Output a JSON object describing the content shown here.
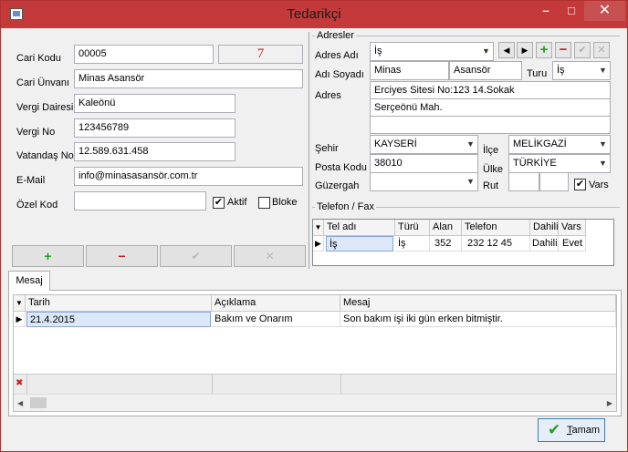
{
  "window": {
    "title": "Tedarikçi",
    "minimize": "–",
    "maximize": "□",
    "close": "✕"
  },
  "left": {
    "cari_kodu_label": "Cari Kodu",
    "cari_kodu": "00005",
    "cari_count": "7",
    "cari_unvani_label": "Cari Ünvanı",
    "cari_unvani": "Minas Asansör",
    "vergi_dairesi_label": "Vergi Dairesi",
    "vergi_dairesi": "Kaleönü",
    "vergi_no_label": "Vergi No",
    "vergi_no": "123456789",
    "vatandas_no_label": "Vatandaş No",
    "vatandas_no": "12.589.631.458",
    "email_label": "E-Mail",
    "email": "info@minasasansör.com.tr",
    "ozel_kod_label": "Özel Kod",
    "ozel_kod": "",
    "aktif_label": "Aktif",
    "aktif_checked": true,
    "bloke_label": "Bloke",
    "bloke_checked": false,
    "buttons": {
      "add": "+",
      "remove": "−",
      "confirm": "✔",
      "cancel": "✕"
    }
  },
  "adresler": {
    "title": "Adresler",
    "adres_adi_label": "Adres Adı",
    "adres_adi": "İş",
    "nav": {
      "prev": "◀",
      "next": "▶",
      "add": "+",
      "remove": "−",
      "confirm": "✔",
      "cancel": "✕"
    },
    "adi_soyadi_label": "Adı Soyadı",
    "adi": "Minas",
    "soyadi": "Asansör",
    "turu_label": "Turu",
    "turu": "İş",
    "adres_label": "Adres",
    "adres_line1": "Erciyes Sitesi No:123 14.Sokak",
    "adres_line2": "Serçeönü Mah.",
    "adres_line3": "",
    "sehir_label": "Şehir",
    "sehir": "KAYSERİ",
    "ilce_label": "İlçe",
    "ilce": "MELİKGAZİ",
    "posta_kodu_label": "Posta Kodu",
    "posta_kodu": "38010",
    "ulke_label": "Ülke",
    "ulke": "TÜRKİYE",
    "guzergah_label": "Güzergah",
    "guzergah": "",
    "rut_label": "Rut",
    "rut1": "",
    "rut2": "",
    "vars_label": "Vars",
    "vars_checked": true
  },
  "telefon": {
    "title": "Telefon / Fax",
    "columns": [
      "Tel adı",
      "Türü",
      "Alan",
      "Telefon",
      "Dahili",
      "Vars"
    ],
    "rows": [
      {
        "tel_adi": "İş",
        "turu": "İş",
        "alan": "352",
        "telefon": "232 12 45",
        "dahili": "Dahili",
        "vars": "Evet"
      }
    ]
  },
  "mesaj": {
    "tab": "Mesaj",
    "columns": [
      "Tarih",
      "Açıklama",
      "Mesaj"
    ],
    "rows": [
      {
        "tarih": "21.4.2015",
        "aciklama": "Bakım ve Onarım",
        "mesaj": "Son bakım işi iki gün erken bitmiştir."
      }
    ]
  },
  "ok_button": {
    "prefix": "T",
    "rest": "amam"
  },
  "colors": {
    "titlebar": "#c43a3a",
    "accent": "#3c7fb1",
    "add_green": "#2a9a2a",
    "remove_red": "#c02020"
  }
}
